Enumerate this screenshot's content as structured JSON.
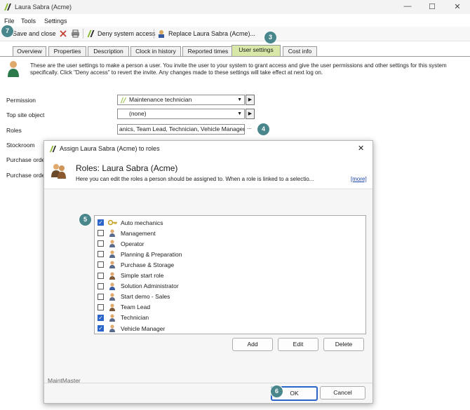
{
  "window": {
    "title": "Laura Sabra (Acme)",
    "controls": [
      "—",
      "☐",
      "✕"
    ]
  },
  "menu": [
    "File",
    "Tools",
    "Settings"
  ],
  "toolbar": {
    "save_close": "Save and close",
    "deny_access": "Deny system access",
    "replace": "Replace Laura Sabra (Acme)..."
  },
  "tabs": [
    "Overview",
    "Properties",
    "Description",
    "Clock in history",
    "Reported times",
    "User settings",
    "Cost info"
  ],
  "active_tab": "User settings",
  "info_text": "These are the user settings to make a person a user. You invite the user to your system to grant access and give the user permissions and other settings for this system specifically. Click \"Deny access\" to revert the invite. Any changes made to these settings will take effect at next log on.",
  "form": {
    "permission_label": "Permission",
    "permission_value": "Maintenance technician",
    "top_site_label": "Top site object",
    "top_site_value": "(none)",
    "roles_label": "Roles",
    "roles_value": "anics, Team Lead, Technician, Vehicle Manager",
    "roles_btn": "...",
    "stockroom_label": "Stockroom",
    "purchase_order1_label": "Purchase orde",
    "purchase_order2_label": "Purchase orde"
  },
  "dialog": {
    "title": "Assign Laura Sabra (Acme) to roles",
    "heading": "Roles: Laura Sabra (Acme)",
    "description": "Here you can edit the roles a person should be assigned to. When a role is linked to a selectio...",
    "more": "[more]",
    "roles": [
      {
        "name": "Auto mechanics",
        "checked": true,
        "icon": "key-icon"
      },
      {
        "name": "Management",
        "checked": false,
        "icon": "person-icon"
      },
      {
        "name": "Operator",
        "checked": false,
        "icon": "person-icon"
      },
      {
        "name": "Planning & Preparation",
        "checked": false,
        "icon": "person-icon"
      },
      {
        "name": "Purchase & Storage",
        "checked": false,
        "icon": "person-icon"
      },
      {
        "name": "Simple start role",
        "checked": false,
        "icon": "people-icon"
      },
      {
        "name": "Solution Administrator",
        "checked": false,
        "icon": "admin-icon"
      },
      {
        "name": "Start demo - Sales",
        "checked": false,
        "icon": "person-icon"
      },
      {
        "name": "Team Lead",
        "checked": false,
        "icon": "people-icon"
      },
      {
        "name": "Technician",
        "checked": true,
        "icon": "person-icon"
      },
      {
        "name": "Vehicle Manager",
        "checked": true,
        "icon": "person-icon"
      }
    ],
    "add": "Add",
    "edit": "Edit",
    "delete": "Delete",
    "footer_brand": "MaintMaster",
    "ok": "OK",
    "cancel": "Cancel"
  },
  "badges": [
    "7",
    "3",
    "4",
    "5",
    "6"
  ],
  "colors": {
    "badge": "#49878c",
    "active_tab": "#d7e8a8",
    "checkbox": "#2b64c8",
    "link": "#1a44a8"
  }
}
